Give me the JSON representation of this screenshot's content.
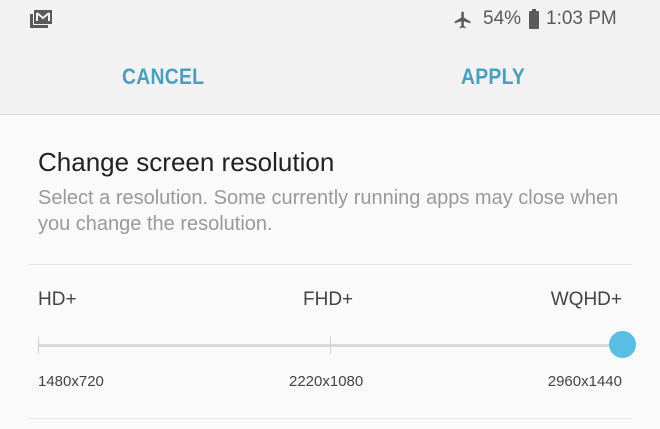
{
  "status_bar": {
    "notification_icon": "gmail-icon",
    "airplane_icon": "airplane-icon",
    "battery_percent": "54%",
    "battery_icon": "battery-icon",
    "time": "1:03 PM"
  },
  "action_bar": {
    "cancel_label": "CANCEL",
    "apply_label": "APPLY",
    "accent_color": "#4a9fbf"
  },
  "content": {
    "title": "Change screen resolution",
    "description": "Select a resolution. Some currently running apps may close when you change the resolution."
  },
  "slider": {
    "options": [
      {
        "label": "HD+",
        "resolution": "1480x720"
      },
      {
        "label": "FHD+",
        "resolution": "2220x1080"
      },
      {
        "label": "WQHD+",
        "resolution": "2960x1440"
      }
    ],
    "selected_index": 2,
    "thumb_color": "#59bde4"
  }
}
